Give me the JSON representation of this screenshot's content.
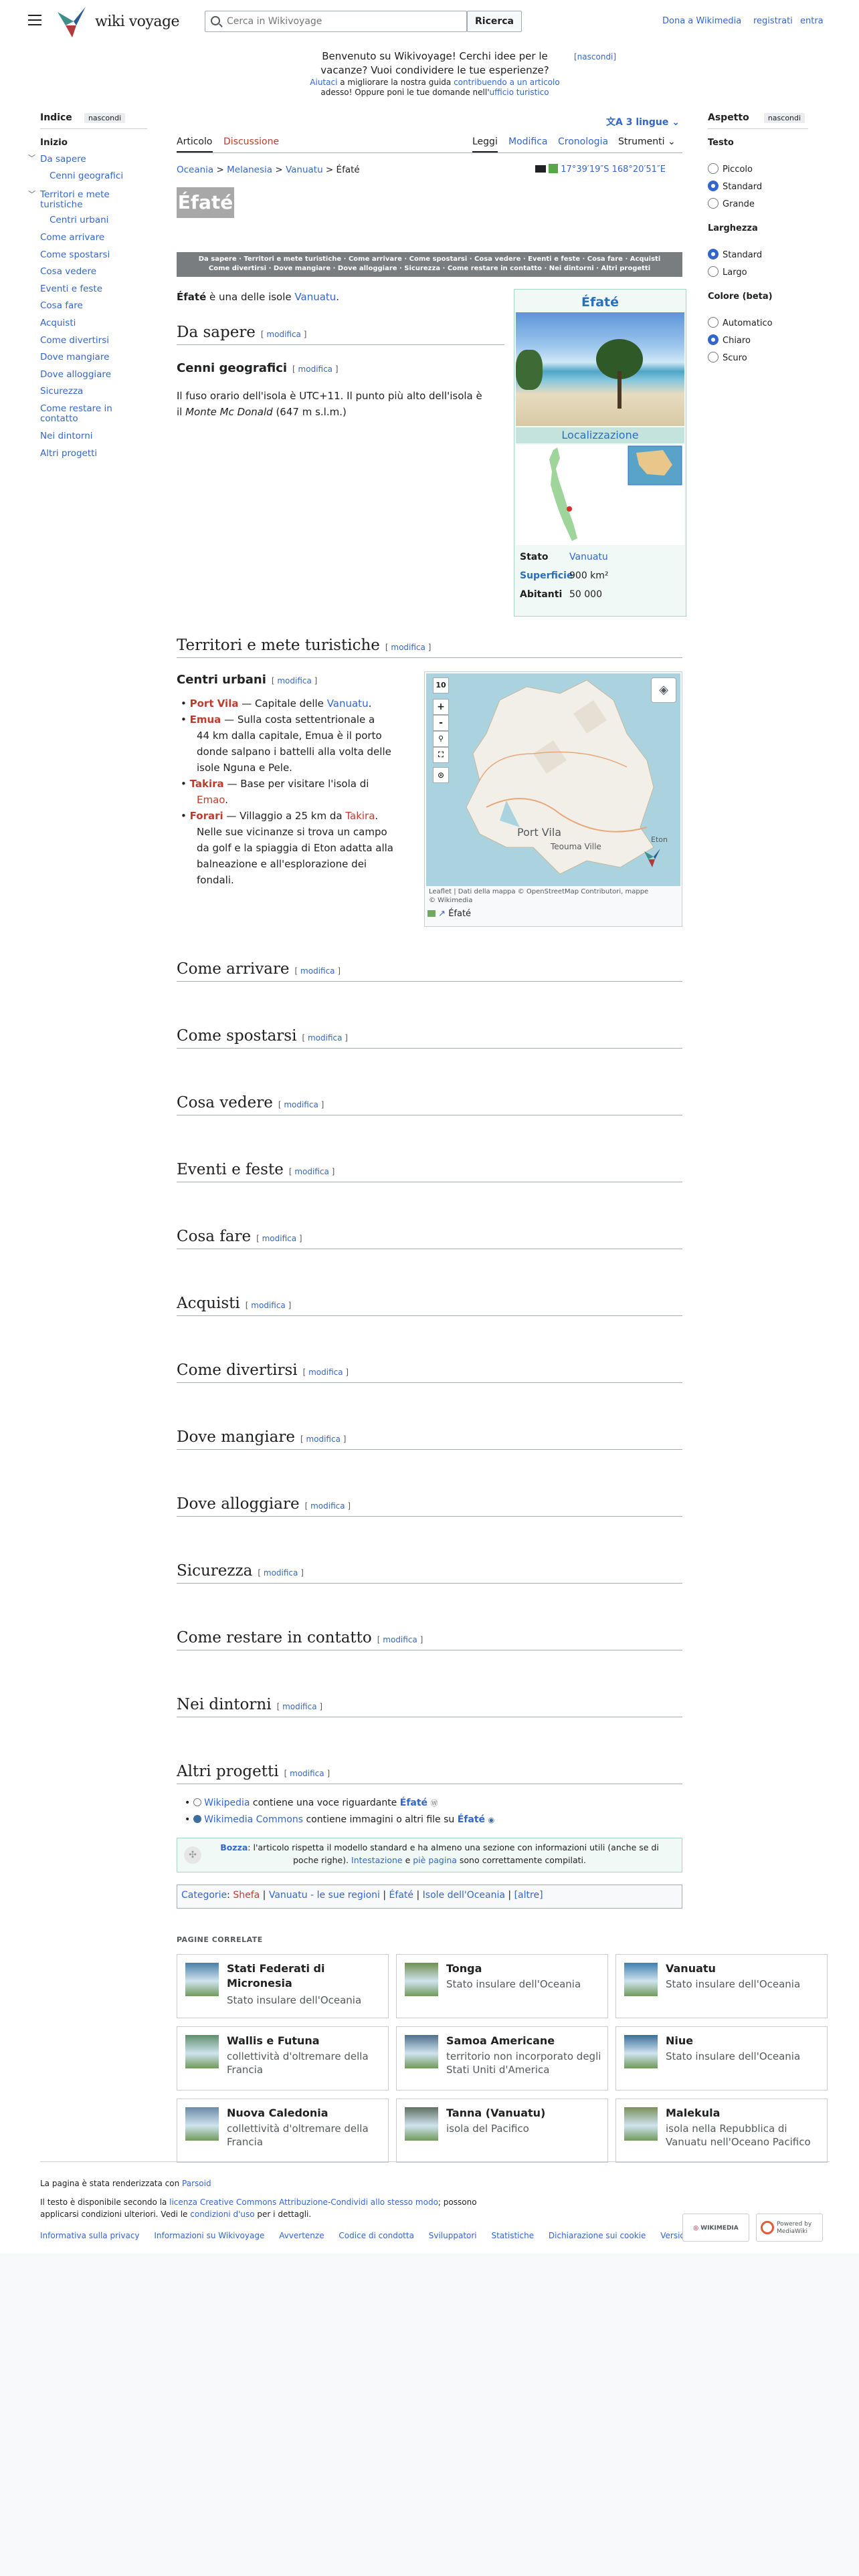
{
  "header": {
    "logo_text": "wiki voyage",
    "search_placeholder": "Cerca in Wikivoyage",
    "search_button": "Ricerca",
    "donate": "Dona a Wikimedia",
    "register": "registrati",
    "login": "entra"
  },
  "banner": {
    "line1": "Benvenuto su Wikivoyage! Cerchi idee per le",
    "line2": "vacanze? Vuoi condividere le tue esperienze?",
    "small1a": "Aiutaci",
    "small1b": " a migliorare la nostra guida ",
    "small1c": "contribuendo a un articolo",
    "small2a": "adesso! Oppure poni le tue domande nell'",
    "small2b": "ufficio turistico",
    "hide": "[nascondi]"
  },
  "toc": {
    "title": "Indice",
    "hide": "nascondi",
    "items": [
      "Inizio",
      "Da sapere",
      "Cenni geografici",
      "Territori e mete turistiche",
      "Centri urbani",
      "Come arrivare",
      "Come spostarsi",
      "Cosa vedere",
      "Eventi e feste",
      "Cosa fare",
      "Acquisti",
      "Come divertirsi",
      "Dove mangiare",
      "Dove alloggiare",
      "Sicurezza",
      "Come restare in contatto",
      "Nei dintorni",
      "Altri progetti"
    ]
  },
  "appearance": {
    "title": "Aspetto",
    "hide": "nascondi",
    "text_label": "Testo",
    "text_options": [
      "Piccolo",
      "Standard",
      "Grande"
    ],
    "width_label": "Larghezza",
    "width_options": [
      "Standard",
      "Largo"
    ],
    "color_label": "Colore (beta)",
    "color_options": [
      "Automatico",
      "Chiaro",
      "Scuro"
    ]
  },
  "tabs": {
    "article": "Articolo",
    "discussion": "Discussione",
    "read": "Leggi",
    "edit": "Modifica",
    "history": "Cronologia",
    "tools": "Strumenti",
    "languages": "3 lingue"
  },
  "breadcrumb": [
    "Oceania",
    "Melanesia",
    "Vanuatu",
    "Éfaté"
  ],
  "coords": "17°39′19″S 168°20′51″E",
  "page_banner_title": "Éfaté",
  "navbar": {
    "line1": "Da sapere · Territori e mete turistiche · Come arrivare · Come spostarsi · Cosa vedere · Eventi e feste · Cosa fare · Acquisti",
    "line2": "Come divertirsi · Dove mangiare · Dove alloggiare · Sicurezza · Come restare in contatto · Nei dintorni · Altri progetti"
  },
  "intro": {
    "bold": "Éfaté",
    "text": " è una delle isole ",
    "link": "Vanuatu",
    "end": "."
  },
  "edit_label": "modifica",
  "sections": {
    "da_sapere": "Da sapere",
    "cenni": "Cenni geografici",
    "cenni_text1": "Il fuso orario dell'isola è UTC+11. Il punto più alto dell'isola è",
    "cenni_text2a": "il ",
    "cenni_text2b": "Monte Mc Donald",
    "cenni_text2c": " (647 m s.l.m.)",
    "territori": "Territori e mete turistiche",
    "centri": "Centri urbani",
    "come_arrivare": "Come arrivare",
    "come_spostarsi": "Come spostarsi",
    "cosa_vedere": "Cosa vedere",
    "eventi": "Eventi e feste",
    "cosa_fare": "Cosa fare",
    "acquisti": "Acquisti",
    "divertirsi": "Come divertirsi",
    "mangiare": "Dove mangiare",
    "alloggiare": "Dove alloggiare",
    "sicurezza": "Sicurezza",
    "contatto": "Come restare in contatto",
    "dintorni": "Nei dintorni",
    "altri": "Altri progetti"
  },
  "cities": [
    {
      "name": "Port Vila",
      "lines": [
        " — Capitale delle ",
        "Vanuatu",
        "."
      ]
    },
    {
      "name": "Emua",
      "lines": [
        " — Sulla costa settentrionale a",
        "44 km dalla capitale, Emua è il porto",
        "donde salpano i battelli alla volta delle",
        "isole Nguna e Pele."
      ]
    },
    {
      "name": "Takira",
      "lines": [
        " — Base per visitare l'isola di",
        "Emao",
        "."
      ]
    },
    {
      "name": "Forari",
      "lines": [
        " — Villaggio a 25 km da ",
        "Takira",
        ".",
        "Nelle sue vicinanze si trova un campo",
        "da golf e la spiaggia di Eton adatta alla",
        "balneazione e all'esplorazione dei",
        "fondali."
      ]
    }
  ],
  "infobox": {
    "title": "Éfaté",
    "loc_label": "Localizzazione",
    "rows": [
      {
        "k": "Stato",
        "v": "Vanuatu"
      },
      {
        "k": "Superficie",
        "v": "900 km²"
      },
      {
        "k": "Abitanti",
        "v": "50 000"
      }
    ]
  },
  "map": {
    "zoom": "10",
    "plus": "+",
    "minus": "-",
    "label_portvila": "Port Vila",
    "label_teouma": "Teouma Ville",
    "label_eton": "Eton",
    "attribution1": "Leaflet | Dati della mappa © OpenStreetMap Contributori, mappe",
    "attribution2": "© Wikimedia",
    "caption": "Éfaté"
  },
  "altri": {
    "wp_link": "Wikipedia",
    "wp_text": " contiene una voce riguardante ",
    "wp_bold": "Éfaté",
    "wc_link": "Wikimedia Commons",
    "wc_text": " contiene immagini o altri file su ",
    "wc_bold": "Éfaté"
  },
  "bozza": {
    "bold": "Bozza",
    "text1": ": l'articolo rispetta il modello standard e ha almeno una sezione con informazioni utili (anche se di",
    "text2a": "poche righe). ",
    "link1": "Intestazione",
    "text2b": " e ",
    "link2": "piè pagina",
    "text2c": " sono correttamente compilati."
  },
  "categories": {
    "label": "Categorie",
    "items": [
      "Shefa",
      "Vanuatu - le sue regioni",
      "Éfaté",
      "Isole dell'Oceania"
    ],
    "more": "[altre]"
  },
  "related": {
    "title": "PAGINE CORRELATE",
    "cards": [
      {
        "title": "Stati Federati di Micronesia",
        "desc": "Stato insulare dell'Oceania",
        "thumb_color": "#4a7fa8"
      },
      {
        "title": "Tonga",
        "desc": "Stato insulare dell'Oceania",
        "thumb_color": "#6f8f4e"
      },
      {
        "title": "Vanuatu",
        "desc": "Stato insulare dell'Oceania",
        "thumb_color": "#3f7fb0"
      },
      {
        "title": "Wallis e Futuna",
        "desc": "collettività d'oltremare della Francia",
        "thumb_color": "#5d8f6a"
      },
      {
        "title": "Samoa Americane",
        "desc": "territorio non incorporato degli Stati Uniti d'America",
        "thumb_color": "#4e6e8c"
      },
      {
        "title": "Niue",
        "desc": "Stato insulare dell'Oceania",
        "thumb_color": "#3a6e9c"
      },
      {
        "title": "Nuova Caledonia",
        "desc": "collettività d'oltremare della Francia",
        "thumb_color": "#6a8aa8"
      },
      {
        "title": "Tanna (Vanuatu)",
        "desc": "isola del Pacifico",
        "thumb_color": "#5f6f62"
      },
      {
        "title": "Malekula",
        "desc": "isola nella Repubblica di Vanuatu nell'Oceano Pacifico",
        "thumb_color": "#7a8f5a"
      }
    ]
  },
  "footer": {
    "rendered": "La pagina è stata renderizzata con ",
    "parsoid": "Parsoid",
    "license1": "Il testo è disponibile secondo la ",
    "license_link": "licenza Creative Commons Attribuzione-Condividi allo stesso modo",
    "license2": "; possono",
    "license3": "applicarsi condizioni ulteriori. Vedi le ",
    "terms": "condizioni d'uso",
    "license4": " per i dettagli.",
    "links": [
      "Informativa sulla privacy",
      "Informazioni su Wikivoyage",
      "Avvertenze",
      "Codice di condotta",
      "Sviluppatori",
      "Statistiche",
      "Dichiarazione sui cookie",
      "Versione mobile"
    ],
    "badge1": "WIKIMEDIA",
    "badge2": "Powered by MediaWiki"
  }
}
